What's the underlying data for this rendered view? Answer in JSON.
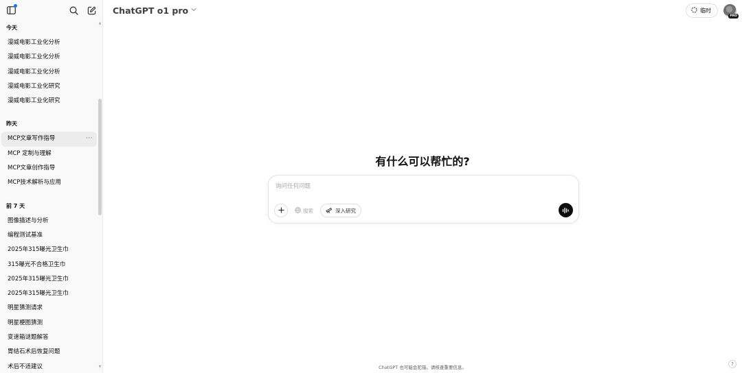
{
  "sidebar": {
    "groups": [
      {
        "heading": "今天",
        "items": [
          "漫威电影工业化分析",
          "漫威电影工业化分析",
          "漫威电影工业化分析",
          "漫威电影工业化研究",
          "漫威电影工业化研究"
        ]
      },
      {
        "heading": "昨天",
        "items": [
          "MCP文章写作指导",
          "MCP 定制与理解",
          "MCP文章创作指导",
          "MCP技术解析与应用"
        ],
        "active_item": "MCP文章写作指导",
        "active_more": "···"
      },
      {
        "heading": "前 7 天",
        "items": [
          "图像描述与分析",
          "编程测试基准",
          "2025年315曝光卫生巾",
          "315曝光不合格卫生巾",
          "2025年315曝光卫生巾",
          "2025年315曝光卫生巾",
          "明星猜测请求",
          "明星梗图猜测",
          "变速箱谜题解答",
          "胃结石术后恢复问题",
          "术后不适建议"
        ]
      }
    ]
  },
  "header": {
    "model_name": "ChatGPT o1 pro",
    "temporary_label": "临时",
    "pro_badge": "PRO"
  },
  "main": {
    "greeting": "有什么可以帮忙的?",
    "composer": {
      "placeholder": "询问任何问题",
      "search_label": "搜索",
      "deep_research_label": "深入研究"
    },
    "footer_note": "ChatGPT 也可能会犯错。请核查重要信息。",
    "help_label": "?"
  },
  "icons": {
    "sidebar_toggle": "sidebar-toggle-icon",
    "search": "search-icon",
    "new_chat": "new-chat-icon",
    "temporary": "dashed-circle-icon",
    "plus": "plus-icon",
    "globe": "globe-icon",
    "telescope": "telescope-icon",
    "voice": "voice-wave-icon"
  },
  "colors": {
    "sidebar_bg": "#f9f9f9",
    "active_item_bg": "#ececec",
    "accent_dot": "#1a73ff",
    "voice_button": "#0d0d0d"
  }
}
